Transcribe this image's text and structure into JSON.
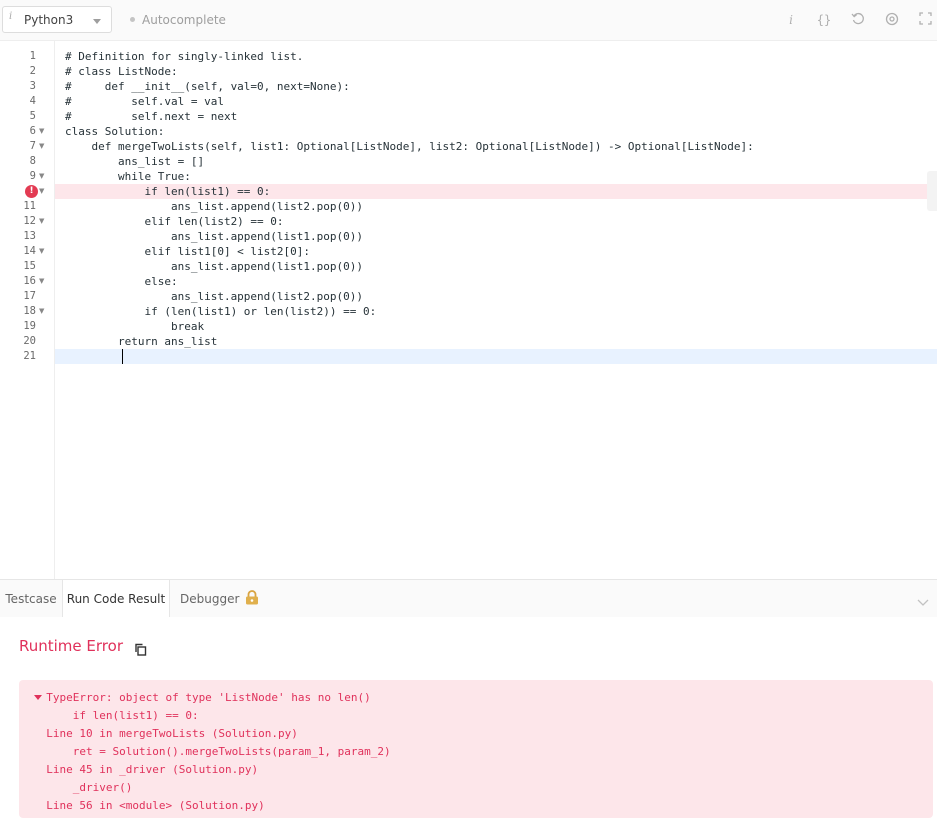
{
  "toolbar": {
    "language_badge": "i",
    "language": "Python3",
    "autocomplete_label": "Autocomplete",
    "icons": [
      "info-icon",
      "braces-icon",
      "reset-icon",
      "settings-icon",
      "fullscreen-icon"
    ]
  },
  "editor": {
    "lines": [
      {
        "n": "1",
        "text": "# Definition for singly-linked list."
      },
      {
        "n": "2",
        "text": "# class ListNode:"
      },
      {
        "n": "3",
        "text": "#     def __init__(self, val=0, next=None):"
      },
      {
        "n": "4",
        "text": "#         self.val = val"
      },
      {
        "n": "5",
        "text": "#         self.next = next"
      },
      {
        "n": "6",
        "text": "class Solution:"
      },
      {
        "n": "7",
        "text": "    def mergeTwoLists(self, list1: Optional[ListNode], list2: Optional[ListNode]) -> Optional[ListNode]:"
      },
      {
        "n": "8",
        "text": "        ans_list = []"
      },
      {
        "n": "9",
        "text": "        while True:"
      },
      {
        "n": "10",
        "text": "            if len(list1) == 0:"
      },
      {
        "n": "11",
        "text": "                ans_list.append(list2.pop(0))"
      },
      {
        "n": "12",
        "text": "            elif len(list2) == 0:"
      },
      {
        "n": "13",
        "text": "                ans_list.append(list1.pop(0))"
      },
      {
        "n": "14",
        "text": "            elif list1[0] < list2[0]:"
      },
      {
        "n": "15",
        "text": "                ans_list.append(list1.pop(0))"
      },
      {
        "n": "16",
        "text": "            else:"
      },
      {
        "n": "17",
        "text": "                ans_list.append(list2.pop(0))"
      },
      {
        "n": "18",
        "text": "            if (len(list1) or len(list2)) == 0:"
      },
      {
        "n": "19",
        "text": "                break"
      },
      {
        "n": "20",
        "text": "        return ans_list"
      },
      {
        "n": "21",
        "text": ""
      }
    ],
    "error_marker": "!"
  },
  "panel": {
    "tabs": [
      "Testcase",
      "Run Code Result",
      "Debugger"
    ],
    "active_tab": "Run Code Result",
    "result_title": "Runtime Error",
    "error_lines": [
      "  TypeError: object of type 'ListNode' has no len()",
      "      if len(list1) == 0:",
      "  Line 10 in mergeTwoLists (Solution.py)",
      "      ret = Solution().mergeTwoLists(param_1, param_2)",
      "  Line 45 in _driver (Solution.py)",
      "      _driver()",
      "  Line 56 in <module> (Solution.py)"
    ]
  },
  "colors": {
    "error_red": "#e0315b",
    "error_bg": "#fde6ea",
    "comment_blue": "#3f6fc5",
    "keyword_blue": "#2448cc"
  }
}
